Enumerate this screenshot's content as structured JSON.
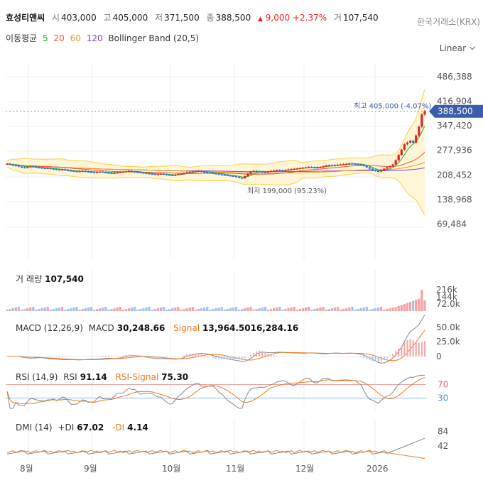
{
  "header": {
    "name": "효성티앤씨",
    "open_label": "시",
    "open": "403,000",
    "high_label": "고",
    "high": "405,000",
    "low_label": "저",
    "low": "371,500",
    "close_label": "종",
    "close": "388,500",
    "change_arrow": "▲",
    "change": "9,000",
    "change_pct": "+2.37%",
    "volume_label": "거",
    "volume": "107,540",
    "exchange": "한국거래소(KRX)"
  },
  "indicators": {
    "ma_label": "이동평균",
    "ma5": "5",
    "ma20": "20",
    "ma60": "60",
    "ma120": "120",
    "bb_label": "Bollinger Band (20,5)",
    "scale": "Linear"
  },
  "colors": {
    "up": "#e0271f",
    "down": "#2f6fd6",
    "ma5": "#22aa33",
    "ma20": "#ee5533",
    "ma60": "#ee9922",
    "ma120": "#8844cc",
    "bb": "#f5d24a",
    "bbfill": "#fff6d8",
    "signal": "#ee7a1e",
    "price_tag": "#3b5bab"
  },
  "chart_data": [
    {
      "type": "candlestick",
      "title": "",
      "x_ticks": [
        "8월",
        "9월",
        "10월",
        "11월",
        "12월",
        "2026"
      ],
      "y_ticks": [
        "486,388",
        "416,904",
        "347,420",
        "277,936",
        "208,452",
        "138,968",
        "69,484"
      ],
      "ylim": [
        0,
        486388
      ],
      "last_price": "388,500",
      "high_annotation": "최고 405,000 (-4.07%)",
      "low_annotation": "최저 199,000 (95.23%)",
      "close": [
        240000,
        238000,
        235000,
        236000,
        232000,
        230000,
        229000,
        231000,
        233000,
        232000,
        230000,
        229000,
        228000,
        227000,
        228000,
        226000,
        225000,
        224000,
        223000,
        224000,
        222000,
        221000,
        220000,
        219000,
        218000,
        219000,
        220000,
        218000,
        217000,
        216000,
        215000,
        217000,
        218000,
        216000,
        215000,
        214000,
        213000,
        214000,
        216000,
        217000,
        218000,
        219000,
        220000,
        218000,
        217000,
        216000,
        215000,
        214000,
        213000,
        212000,
        211000,
        210000,
        211000,
        212000,
        210000,
        209000,
        208000,
        207000,
        209000,
        211000,
        212000,
        214000,
        216000,
        217000,
        218000,
        219000,
        220000,
        218000,
        216000,
        215000,
        214000,
        213000,
        212000,
        210000,
        209000,
        208000,
        207000,
        206000,
        205000,
        203000,
        201000,
        199000,
        205000,
        212000,
        218000,
        220000,
        219000,
        218000,
        217000,
        216000,
        218000,
        220000,
        221000,
        222000,
        221000,
        220000,
        222000,
        224000,
        225000,
        226000,
        227000,
        228000,
        229000,
        230000,
        231000,
        230000,
        229000,
        230000,
        231000,
        233000,
        235000,
        236000,
        235000,
        236000,
        237000,
        238000,
        239000,
        240000,
        241000,
        240000,
        239000,
        238000,
        237000,
        234000,
        230000,
        226000,
        222000,
        220000,
        218000,
        222000,
        226000,
        230000,
        233000,
        238000,
        250000,
        265000,
        280000,
        295000,
        300000,
        305000,
        300000,
        320000,
        345000,
        379500,
        388500
      ],
      "volume_ticks": [
        "216k",
        "144k",
        "72.0k"
      ],
      "volume_last": "107,540",
      "macd": {
        "label": "MACD (12,26,9)",
        "macd_label": "MACD",
        "macd": "30,248.66",
        "signal_label": "Signal",
        "signal": "13,964.5016,284.16",
        "ticks": [
          "50.0k",
          "25.0k",
          "0"
        ]
      },
      "rsi": {
        "label": "RSI (14,9)",
        "rsi_label": "RSI",
        "rsi": "91.14",
        "signal_label": "RSI-Signal",
        "signal": "75.30",
        "ticks": [
          "70",
          "30"
        ]
      },
      "dmi": {
        "label": "DMI (14)",
        "pdi_label": "+DI",
        "pdi": "67.02",
        "mdi_label": "-DI",
        "mdi": "4.14",
        "ticks": [
          "84",
          "42"
        ]
      }
    }
  ]
}
